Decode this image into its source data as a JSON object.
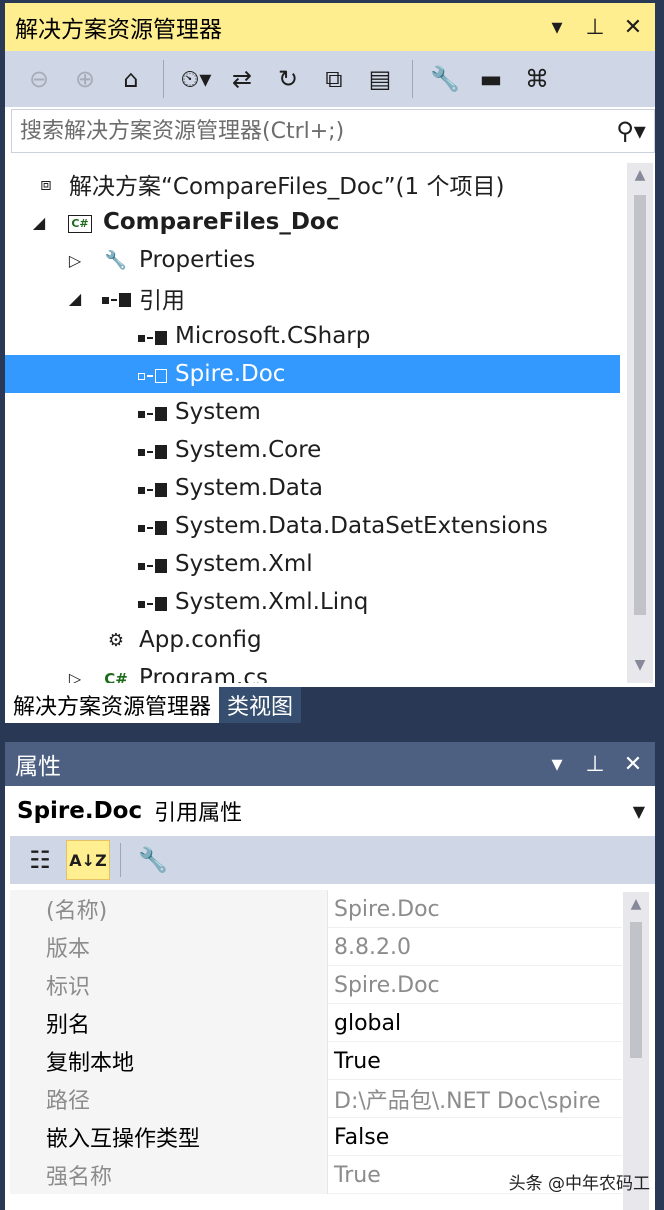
{
  "solution_explorer": {
    "title": "解决方案资源管理器",
    "title_buttons": [
      "chevron-down-icon",
      "pin-icon",
      "close-icon"
    ],
    "search_placeholder": "搜索解决方案资源管理器(Ctrl+;)",
    "tree": [
      {
        "indent": 0,
        "expander": "",
        "icon": "solution-icon",
        "label": "解决方案“CompareFiles_Doc”(1 个项目)",
        "bold": false
      },
      {
        "indent": 0,
        "expander": "expanded",
        "icon": "csharp-project-icon",
        "label": "CompareFiles_Doc",
        "bold": true
      },
      {
        "indent": 1,
        "expander": "collapsed",
        "icon": "wrench-icon",
        "label": "Properties",
        "bold": false
      },
      {
        "indent": 1,
        "expander": "expanded",
        "icon": "reference-icon",
        "label": "引用",
        "bold": false
      },
      {
        "indent": 2,
        "expander": "",
        "icon": "reference-icon",
        "label": "Microsoft.CSharp",
        "bold": false
      },
      {
        "indent": 2,
        "expander": "",
        "icon": "reference-icon",
        "label": "Spire.Doc",
        "bold": false,
        "selected": true
      },
      {
        "indent": 2,
        "expander": "",
        "icon": "reference-icon",
        "label": "System",
        "bold": false
      },
      {
        "indent": 2,
        "expander": "",
        "icon": "reference-icon",
        "label": "System.Core",
        "bold": false
      },
      {
        "indent": 2,
        "expander": "",
        "icon": "reference-icon",
        "label": "System.Data",
        "bold": false
      },
      {
        "indent": 2,
        "expander": "",
        "icon": "reference-icon",
        "label": "System.Data.DataSetExtensions",
        "bold": false
      },
      {
        "indent": 2,
        "expander": "",
        "icon": "reference-icon",
        "label": "System.Xml",
        "bold": false
      },
      {
        "indent": 2,
        "expander": "",
        "icon": "reference-icon",
        "label": "System.Xml.Linq",
        "bold": false
      },
      {
        "indent": 1,
        "expander": "",
        "icon": "config-file-icon",
        "label": "App.config",
        "bold": false
      },
      {
        "indent": 1,
        "expander": "collapsed",
        "icon": "csharp-file-icon",
        "label": "Program.cs",
        "bold": false
      }
    ],
    "tabs": [
      {
        "label": "解决方案资源管理器",
        "active": true
      },
      {
        "label": "类视图",
        "active": false
      }
    ]
  },
  "properties": {
    "title": "属性",
    "object_name": "Spire.Doc",
    "object_type": "引用属性",
    "rows": [
      {
        "name": "(名称)",
        "value": "Spire.Doc",
        "readonly": true
      },
      {
        "name": "版本",
        "value": "8.8.2.0",
        "readonly": true
      },
      {
        "name": "标识",
        "value": "Spire.Doc",
        "readonly": true
      },
      {
        "name": "别名",
        "value": "global",
        "readonly": false
      },
      {
        "name": "复制本地",
        "value": "True",
        "readonly": false
      },
      {
        "name": "路径",
        "value": "D:\\产品包\\.NET Doc\\spire",
        "readonly": true
      },
      {
        "name": "嵌入互操作类型",
        "value": "False",
        "readonly": false
      },
      {
        "name": "强名称",
        "value": "True",
        "readonly": true
      }
    ]
  },
  "watermark": "头条 @中年农码工",
  "colors": {
    "title_active": "#ffee8f",
    "title_inactive": "#4d6082",
    "selection": "#3399ff",
    "frame": "#293955"
  }
}
